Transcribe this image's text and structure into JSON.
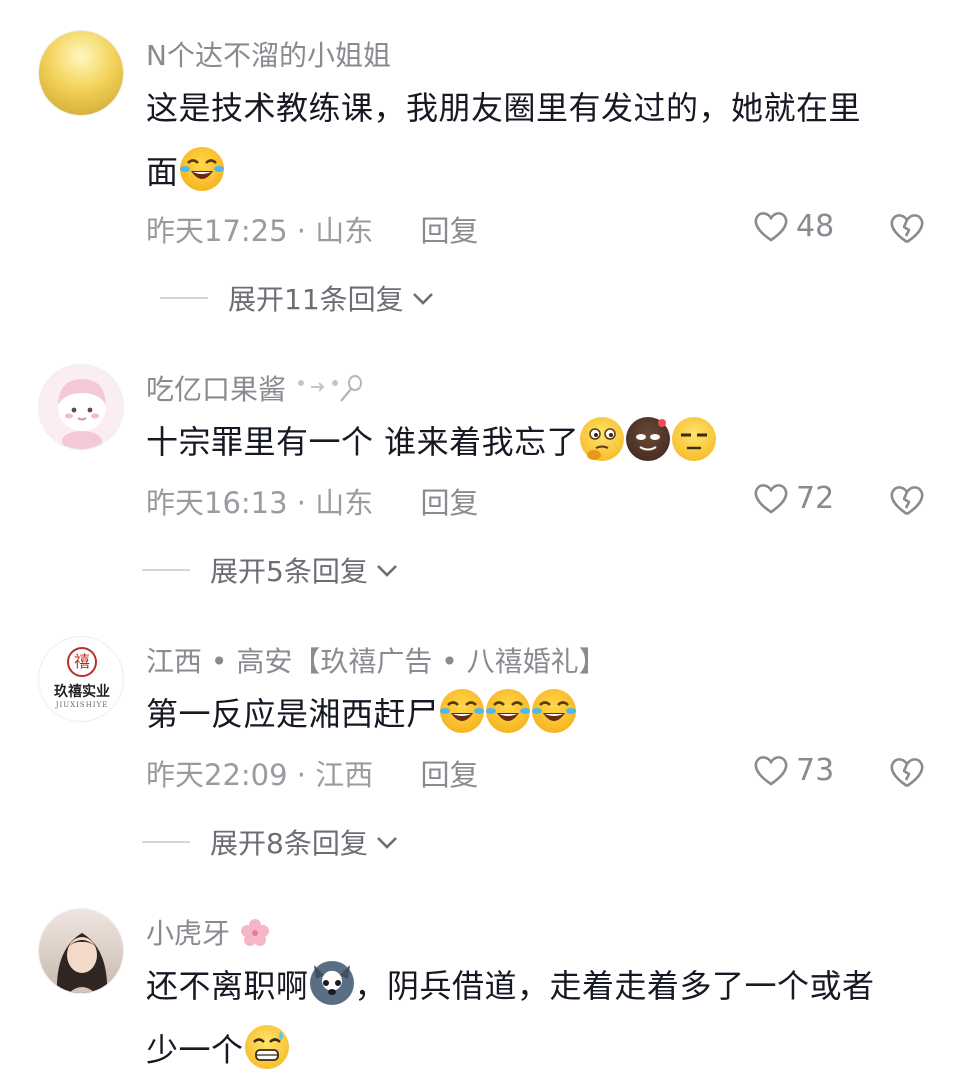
{
  "comments": [
    {
      "username": "N个达不溜的小姐姐",
      "text_a": "这是技术教练课，我朋友圈里有发过的，她就在里",
      "text_b": "面",
      "time": "昨天17:25",
      "location": "山东",
      "reply_label": "回复",
      "likes": "48",
      "expand_label": "展开11条回复",
      "emojis": [
        "laugh-cry-emoji"
      ]
    },
    {
      "username": "吃亿口果酱",
      "text_a": "十宗罪里有一个 谁来着我忘了",
      "time": "昨天16:13",
      "location": "山东",
      "reply_label": "回复",
      "likes": "72",
      "expand_label": "展开5条回复",
      "emojis": [
        "thinking-emoji",
        "dark-face-emoji",
        "unamused-emoji"
      ]
    },
    {
      "username": "江西 • 高安【玖禧广告 • 八禧婚礼】",
      "avatar_text": "玖禧实业",
      "avatar_sub": "JIUXISHIYE",
      "avatar_seal": "禧",
      "text_a": "第一反应是湘西赶尸",
      "time": "昨天22:09",
      "location": "江西",
      "reply_label": "回复",
      "likes": "73",
      "expand_label": "展开8条回复",
      "emojis": [
        "laugh-cry-emoji",
        "laugh-cry-emoji",
        "laugh-cry-emoji"
      ]
    },
    {
      "username": "小虎牙",
      "text_a": "还不离职啊",
      "text_a2": "，阴兵借道，走着走着多了一个或者",
      "text_b": "少一个",
      "emojis": [
        "husky-emoji",
        "sweat-grin-emoji"
      ]
    }
  ],
  "separator": "·"
}
